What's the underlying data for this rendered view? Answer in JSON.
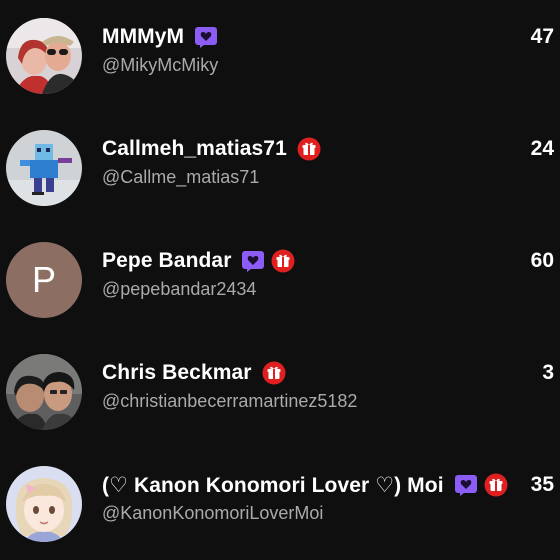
{
  "colors": {
    "background": "#0f0f0f",
    "member_badge": "#8b5cf6",
    "gift_badge": "#e02020",
    "handle_text": "#aaaaaa"
  },
  "users": [
    {
      "display_name": "MMMyM",
      "handle": "@MikyMcMiky",
      "count": "47",
      "badges": [
        "member-heart-badge"
      ],
      "avatar": "photo"
    },
    {
      "display_name": "Callmeh_matias71",
      "handle": "@Callme_matias71",
      "count": "24",
      "badges": [
        "gift-badge"
      ],
      "avatar": "photo"
    },
    {
      "display_name": "Pepe Bandar",
      "handle": "@pepebandar2434",
      "count": "60",
      "badges": [
        "member-heart-badge",
        "gift-badge"
      ],
      "avatar": "letter",
      "avatar_letter": "P",
      "avatar_color": "#8d6e63"
    },
    {
      "display_name": "Chris Beckmar",
      "handle": "@christianbecerramartinez5182",
      "count": "3",
      "badges": [
        "gift-badge"
      ],
      "avatar": "photo"
    },
    {
      "display_name": "(♡ Kanon Konomori Lover ♡) Moi",
      "handle": "@KanonKonomoriLoverMoi",
      "count": "35",
      "badges": [
        "member-heart-badge",
        "gift-badge"
      ],
      "avatar": "photo"
    }
  ]
}
